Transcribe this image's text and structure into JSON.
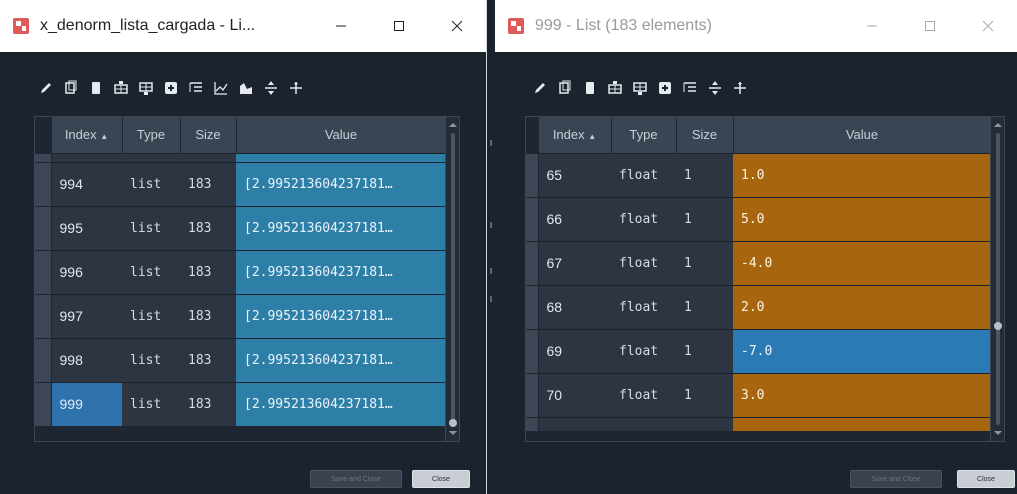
{
  "left_window": {
    "title": "x_denorm_lista_cargada - Li...",
    "headers": {
      "index": "Index",
      "type": "Type",
      "size": "Size",
      "value": "Value"
    },
    "sort_indicator": "▲",
    "rows": [
      {
        "index": "994",
        "type": "list",
        "size": "183",
        "value": "[2.995213604237181…"
      },
      {
        "index": "995",
        "type": "list",
        "size": "183",
        "value": "[2.995213604237181…"
      },
      {
        "index": "996",
        "type": "list",
        "size": "183",
        "value": "[2.995213604237181…"
      },
      {
        "index": "997",
        "type": "list",
        "size": "183",
        "value": "[2.995213604237181…"
      },
      {
        "index": "998",
        "type": "list",
        "size": "183",
        "value": "[2.995213604237181…"
      },
      {
        "index": "999",
        "type": "list",
        "size": "183",
        "value": "[2.995213604237181…"
      }
    ],
    "selected_index": "999",
    "toolbar_icons": [
      "edit-icon",
      "copy-icon",
      "paste-icon",
      "insert-row-above-icon",
      "insert-row-below-icon",
      "add-icon",
      "indent-icon",
      "line-chart-icon",
      "area-chart-icon",
      "expand-icon",
      "collapse-icon"
    ],
    "buttons": {
      "save_close": "Save and Close",
      "close": "Close"
    }
  },
  "right_window": {
    "title": "999 - List (183 elements)",
    "headers": {
      "index": "Index",
      "type": "Type",
      "size": "Size",
      "value": "Value"
    },
    "sort_indicator": "▲",
    "rows": [
      {
        "index": "65",
        "type": "float",
        "size": "1",
        "value": "1.0"
      },
      {
        "index": "66",
        "type": "float",
        "size": "1",
        "value": "5.0"
      },
      {
        "index": "67",
        "type": "float",
        "size": "1",
        "value": "-4.0"
      },
      {
        "index": "68",
        "type": "float",
        "size": "1",
        "value": "2.0"
      },
      {
        "index": "69",
        "type": "float",
        "size": "1",
        "value": "-7.0"
      },
      {
        "index": "70",
        "type": "float",
        "size": "1",
        "value": "3.0"
      }
    ],
    "selected_index": "69",
    "toolbar_icons": [
      "edit-icon",
      "copy-icon",
      "paste-icon",
      "insert-row-above-icon",
      "insert-row-below-icon",
      "add-icon",
      "indent-icon",
      "expand-icon",
      "collapse-icon"
    ],
    "buttons": {
      "save_close": "Save and Close",
      "close": "Close"
    }
  },
  "colors": {
    "window_bg": "#1b232f",
    "header_bg": "#3a4553",
    "selection_blue": "#2e73ae",
    "list_value_bg": "#2e7fa8",
    "float_value_bg": "#a8650f"
  }
}
